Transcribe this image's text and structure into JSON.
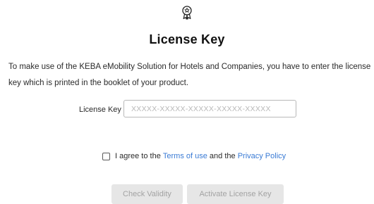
{
  "header": {
    "icon": "award-badge-icon",
    "title": "License Key"
  },
  "intro": {
    "text": "To make use of the KEBA eMobility Solution for Hotels and Companies, you have to enter the license key which is printed in the booklet of your product."
  },
  "license_form": {
    "label": "License Key",
    "placeholder": "XXXXX-XXXXX-XXXXX-XXXXX-XXXXX",
    "value": ""
  },
  "agreement": {
    "checked": false,
    "prefix": "I agree to the",
    "terms_link": "Terms of use",
    "middle": "and the",
    "privacy_link": "Privacy Policy"
  },
  "actions": {
    "check_validity_label": "Check Validity",
    "activate_label": "Activate License Key"
  },
  "colors": {
    "link": "#3a7bd5",
    "button_disabled_bg": "#e6e6e6",
    "button_disabled_text": "#a3a3a3"
  }
}
